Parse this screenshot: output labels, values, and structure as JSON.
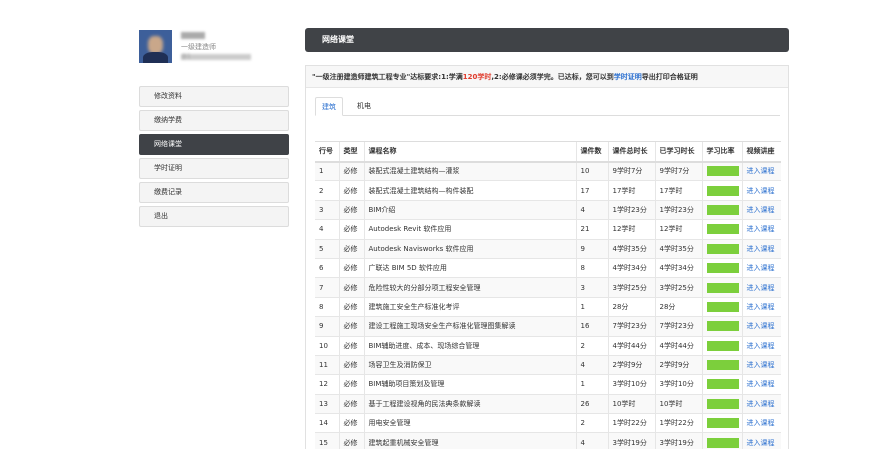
{
  "profile": {
    "level": "一级建造师",
    "phone_prefix": "@1"
  },
  "menu": [
    {
      "label": "修改资料",
      "active": false
    },
    {
      "label": "缴纳学费",
      "active": false
    },
    {
      "label": "网络课堂",
      "active": true
    },
    {
      "label": "学时证明",
      "active": false
    },
    {
      "label": "缴费记录",
      "active": false
    },
    {
      "label": "退出",
      "active": false
    }
  ],
  "header": {
    "title": "网络课堂"
  },
  "notice": {
    "part1": "\"一级注册建造师建筑工程专业\"达标要求:1:学满",
    "hours": "120学时",
    "part2": ",2:必修课必须学完。已达标，您可以到",
    "link": "学时证明",
    "part3": "导出打印合格证明"
  },
  "tabs": [
    {
      "label": "建筑",
      "active": true
    },
    {
      "label": "机电",
      "active": false
    }
  ],
  "table": {
    "headers": [
      "行号",
      "类型",
      "课程名称",
      "课件数",
      "课件总时长",
      "已学习时长",
      "学习比率",
      "视频讲座"
    ],
    "rows": [
      {
        "no": "1",
        "type": "必修",
        "name": "装配式混凝土建筑结构—灌浆",
        "count": "10",
        "total": "9学时7分",
        "learned": "9学时7分",
        "ratio": 1.0,
        "action": "进入课程"
      },
      {
        "no": "2",
        "type": "必修",
        "name": "装配式混凝土建筑结构—构件装配",
        "count": "17",
        "total": "17学时",
        "learned": "17学时",
        "ratio": 1.0,
        "action": "进入课程"
      },
      {
        "no": "3",
        "type": "必修",
        "name": "BIM介绍",
        "count": "4",
        "total": "1学时23分",
        "learned": "1学时23分",
        "ratio": 1.0,
        "action": "进入课程"
      },
      {
        "no": "4",
        "type": "必修",
        "name": "Autodesk Revit 软件应用",
        "count": "21",
        "total": "12学时",
        "learned": "12学时",
        "ratio": 1.0,
        "action": "进入课程"
      },
      {
        "no": "5",
        "type": "必修",
        "name": "Autodesk Navisworks 软件应用",
        "count": "9",
        "total": "4学时35分",
        "learned": "4学时35分",
        "ratio": 1.0,
        "action": "进入课程"
      },
      {
        "no": "6",
        "type": "必修",
        "name": "广联达 BIM 5D 软件应用",
        "count": "8",
        "total": "4学时34分",
        "learned": "4学时34分",
        "ratio": 1.0,
        "action": "进入课程"
      },
      {
        "no": "7",
        "type": "必修",
        "name": "危险性较大的分部分项工程安全管理",
        "count": "3",
        "total": "3学时25分",
        "learned": "3学时25分",
        "ratio": 1.0,
        "action": "进入课程"
      },
      {
        "no": "8",
        "type": "必修",
        "name": "建筑施工安全生产标准化考评",
        "count": "1",
        "total": "28分",
        "learned": "28分",
        "ratio": 1.0,
        "action": "进入课程"
      },
      {
        "no": "9",
        "type": "必修",
        "name": "建设工程施工现场安全生产标准化管理图集解读",
        "count": "16",
        "total": "7学时23分",
        "learned": "7学时23分",
        "ratio": 1.0,
        "action": "进入课程"
      },
      {
        "no": "10",
        "type": "必修",
        "name": "BIM辅助进度、成本、现场综合管理",
        "count": "2",
        "total": "4学时44分",
        "learned": "4学时44分",
        "ratio": 1.0,
        "action": "进入课程"
      },
      {
        "no": "11",
        "type": "必修",
        "name": "场容卫生及消防保卫",
        "count": "4",
        "total": "2学时9分",
        "learned": "2学时9分",
        "ratio": 1.0,
        "action": "进入课程"
      },
      {
        "no": "12",
        "type": "必修",
        "name": "BIM辅助项目策划及管理",
        "count": "1",
        "total": "3学时10分",
        "learned": "3学时10分",
        "ratio": 1.0,
        "action": "进入课程"
      },
      {
        "no": "13",
        "type": "必修",
        "name": "基于工程建设视角的民法典条款解读",
        "count": "26",
        "total": "10学时",
        "learned": "10学时",
        "ratio": 1.0,
        "action": "进入课程"
      },
      {
        "no": "14",
        "type": "必修",
        "name": "用电安全管理",
        "count": "2",
        "total": "1学时22分",
        "learned": "1学时22分",
        "ratio": 1.0,
        "action": "进入课程"
      },
      {
        "no": "15",
        "type": "必修",
        "name": "建筑起重机械安全管理",
        "count": "4",
        "total": "3学时19分",
        "learned": "3学时19分",
        "ratio": 1.0,
        "action": "进入课程"
      }
    ]
  },
  "colors": {
    "accent": "#2a6fcf",
    "header_bg": "#404347",
    "progress": "#7ccf3c",
    "highlight": "#e03a2b"
  }
}
